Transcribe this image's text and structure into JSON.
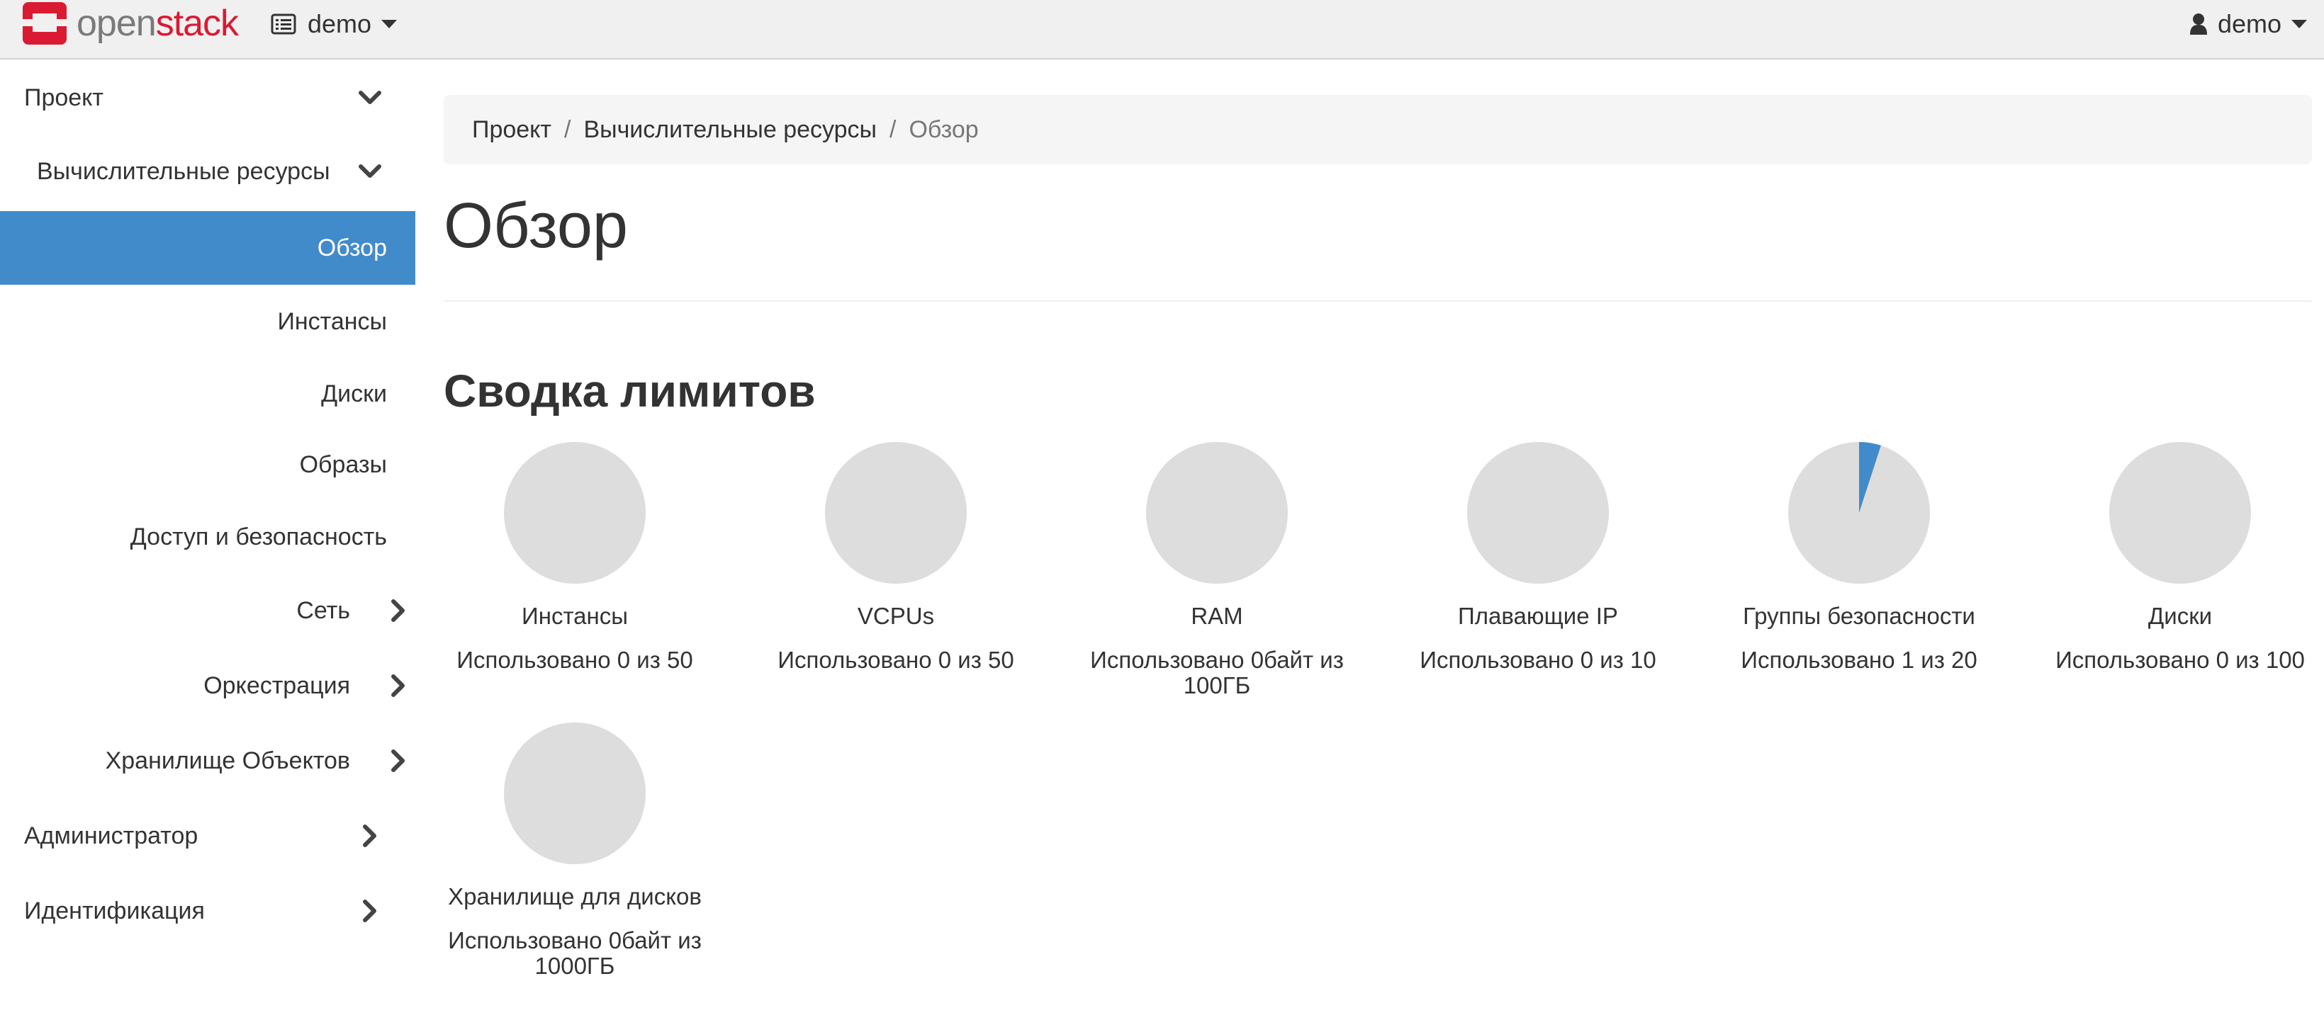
{
  "navbar": {
    "logo_part1": "open",
    "logo_part2": "stack",
    "project": "demo",
    "user": "demo"
  },
  "sidebar": {
    "items": [
      {
        "label": "Проект",
        "icon": "chevron-down-icon"
      },
      {
        "label": "Вычислительные ресурсы",
        "icon": "chevron-down-icon"
      },
      {
        "label": "Обзор",
        "active": true
      },
      {
        "label": "Инстансы"
      },
      {
        "label": "Диски"
      },
      {
        "label": "Образы"
      },
      {
        "label": "Доступ и безопасность"
      },
      {
        "label": "Сеть",
        "icon": "chevron-right-icon"
      },
      {
        "label": "Оркестрация",
        "icon": "chevron-right-icon"
      },
      {
        "label": "Хранилище Объектов",
        "icon": "chevron-right-icon"
      },
      {
        "label": "Администратор",
        "icon": "chevron-right-icon"
      },
      {
        "label": "Идентификация",
        "icon": "chevron-right-icon"
      }
    ]
  },
  "breadcrumb": [
    "Проект",
    "Вычислительные ресурсы",
    "Обзор"
  ],
  "page_title": "Обзор",
  "limits": {
    "title": "Сводка лимитов",
    "colors": {
      "empty": "#dddddd",
      "used": "#428bca"
    },
    "pies": [
      {
        "label": "Инстансы",
        "usage": "Использовано 0 из 50",
        "used": 0,
        "total": 50
      },
      {
        "label": "VCPUs",
        "usage": "Использовано 0 из 50",
        "used": 0,
        "total": 50
      },
      {
        "label": "RAM",
        "usage": "Использовано 0байт из 100ГБ",
        "used": 0,
        "total": 100
      },
      {
        "label": "Плавающие IP",
        "usage": "Использовано 0 из 10",
        "used": 0,
        "total": 10
      },
      {
        "label": "Группы безопасности",
        "usage": "Использовано 1 из 20",
        "used": 1,
        "total": 20
      },
      {
        "label": "Диски",
        "usage": "Использовано 0 из 100",
        "used": 0,
        "total": 100
      },
      {
        "label": "Хранилище для дисков",
        "usage": "Использовано 0байт из 1000ГБ",
        "used": 0,
        "total": 1000
      }
    ]
  }
}
